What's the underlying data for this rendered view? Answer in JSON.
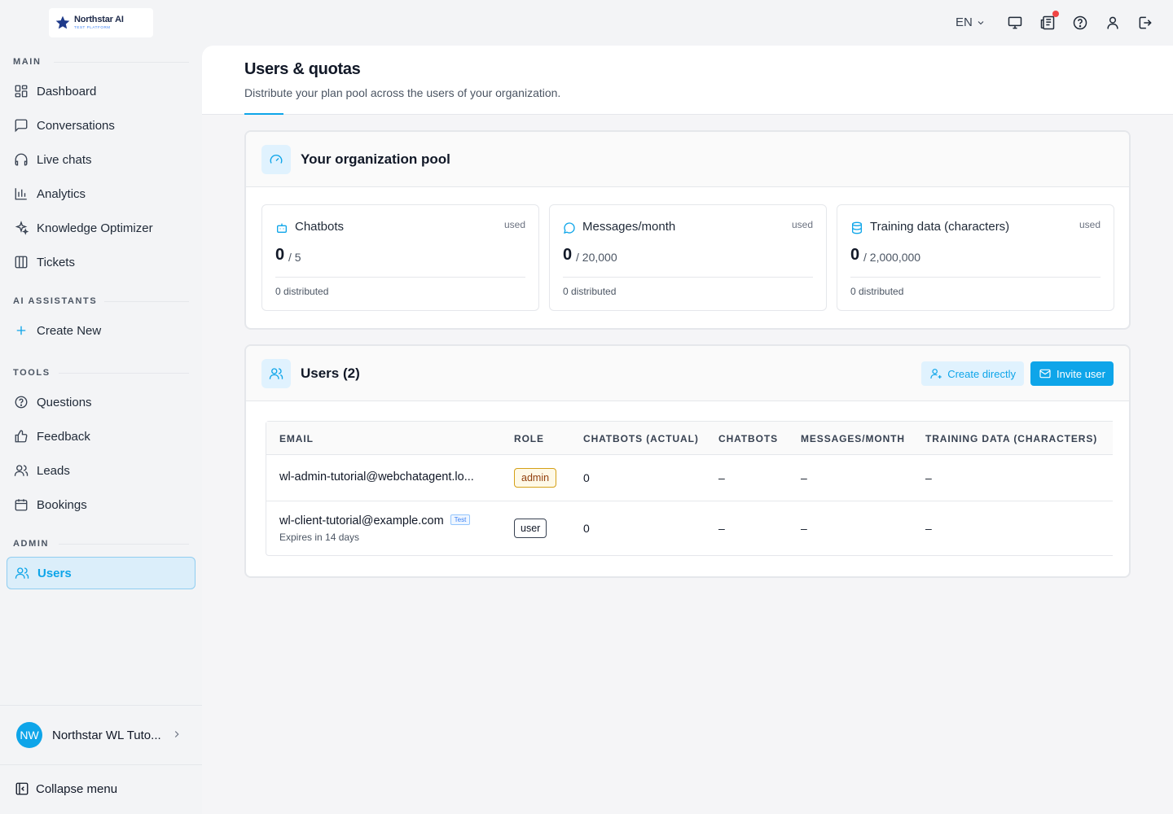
{
  "brand": {
    "name": "Northstar AI",
    "tagline": "TEST PLATFORM"
  },
  "colors": {
    "accent": "#0ea5e9",
    "notification": "#ef4444",
    "admin_badge": "#d4a017"
  },
  "topbar": {
    "language": "EN",
    "icons": [
      "monitor-icon",
      "news-icon",
      "help-icon",
      "user-icon",
      "logout-icon"
    ]
  },
  "sidebar": {
    "sections": {
      "main": "MAIN",
      "ai_assistants": "AI ASSISTANTS",
      "tools": "TOOLS",
      "admin": "ADMIN"
    },
    "main_items": [
      {
        "label": "Dashboard",
        "icon": "grid-icon"
      },
      {
        "label": "Conversations",
        "icon": "chat-icon"
      },
      {
        "label": "Live chats",
        "icon": "headset-icon"
      },
      {
        "label": "Analytics",
        "icon": "bar-chart-icon"
      },
      {
        "label": "Knowledge Optimizer",
        "icon": "sparkles-icon"
      },
      {
        "label": "Tickets",
        "icon": "columns-icon"
      }
    ],
    "assistant_items": [
      {
        "label": "Create New",
        "icon": "plus-icon"
      }
    ],
    "tool_items": [
      {
        "label": "Questions",
        "icon": "question-icon"
      },
      {
        "label": "Feedback",
        "icon": "thumbs-up-icon"
      },
      {
        "label": "Leads",
        "icon": "users-icon"
      },
      {
        "label": "Bookings",
        "icon": "calendar-icon"
      }
    ],
    "admin_items": [
      {
        "label": "Users",
        "icon": "users-icon",
        "active": true
      }
    ],
    "org": {
      "initials": "NW",
      "name": "Northstar WL Tuto..."
    },
    "collapse_label": "Collapse menu"
  },
  "page": {
    "title": "Users & quotas",
    "subtitle": "Distribute your plan pool across the users of your organization."
  },
  "pool": {
    "title": "Your organization pool",
    "stats": [
      {
        "label": "Chatbots",
        "used_label": "used",
        "value": "0",
        "total": "/ 5",
        "distributed": "0 distributed",
        "icon": "bot-icon"
      },
      {
        "label": "Messages/month",
        "used_label": "used",
        "value": "0",
        "total": "/ 20,000",
        "distributed": "0 distributed",
        "icon": "message-circle-icon"
      },
      {
        "label": "Training data (characters)",
        "used_label": "used",
        "value": "0",
        "total": "/ 2,000,000",
        "distributed": "0 distributed",
        "icon": "database-icon"
      }
    ]
  },
  "users": {
    "title": "Users (2)",
    "create_label": "Create directly",
    "invite_label": "Invite user",
    "columns": [
      "EMAIL",
      "ROLE",
      "CHATBOTS (ACTUAL)",
      "CHATBOTS",
      "MESSAGES/MONTH",
      "TRAINING DATA (CHARACTERS)"
    ],
    "rows": [
      {
        "email": "wl-admin-tutorial@webchatagent.lo...",
        "note": "",
        "tag": "",
        "role": "admin",
        "chatbots_actual": "0",
        "chatbots": "–",
        "messages": "–",
        "training": "–"
      },
      {
        "email": "wl-client-tutorial@example.com",
        "note": "Expires in 14 days",
        "tag": "Test",
        "role": "user",
        "chatbots_actual": "0",
        "chatbots": "–",
        "messages": "–",
        "training": "–"
      }
    ]
  }
}
